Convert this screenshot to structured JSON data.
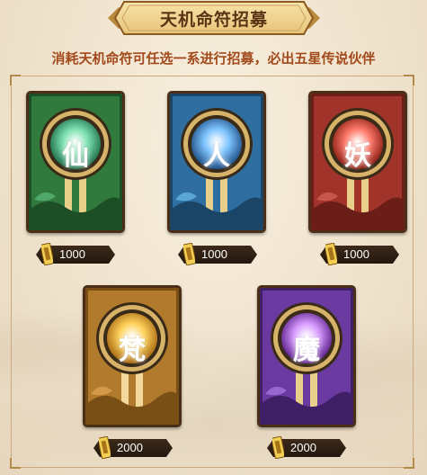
{
  "title": "天机命符招募",
  "subtitle": "消耗天机命符可任选一系进行招募，必出五星传说伙伴",
  "cards": [
    {
      "glyph": "仙",
      "cost": "1000",
      "theme": "green",
      "colors": {
        "bg": "#2f7a3c",
        "dark": "#1d4f26",
        "orb": "#7de0b0"
      }
    },
    {
      "glyph": "人",
      "cost": "1000",
      "theme": "blue",
      "colors": {
        "bg": "#2f6ea0",
        "dark": "#1b4566",
        "orb": "#7fc4ff"
      }
    },
    {
      "glyph": "妖",
      "cost": "1000",
      "theme": "red",
      "colors": {
        "bg": "#a0342a",
        "dark": "#6b1e17",
        "orb": "#ff7a6a"
      }
    },
    {
      "glyph": "梵",
      "cost": "2000",
      "theme": "gold",
      "colors": {
        "bg": "#b27a2c",
        "dark": "#7a4f16",
        "orb": "#ffd25c"
      }
    },
    {
      "glyph": "魔",
      "cost": "2000",
      "theme": "purple",
      "colors": {
        "bg": "#6a3aa0",
        "dark": "#3f1f66",
        "orb": "#d79bff"
      }
    }
  ],
  "icons": {
    "currency": "talisman-icon",
    "banner": "scroll-banner-icon"
  }
}
